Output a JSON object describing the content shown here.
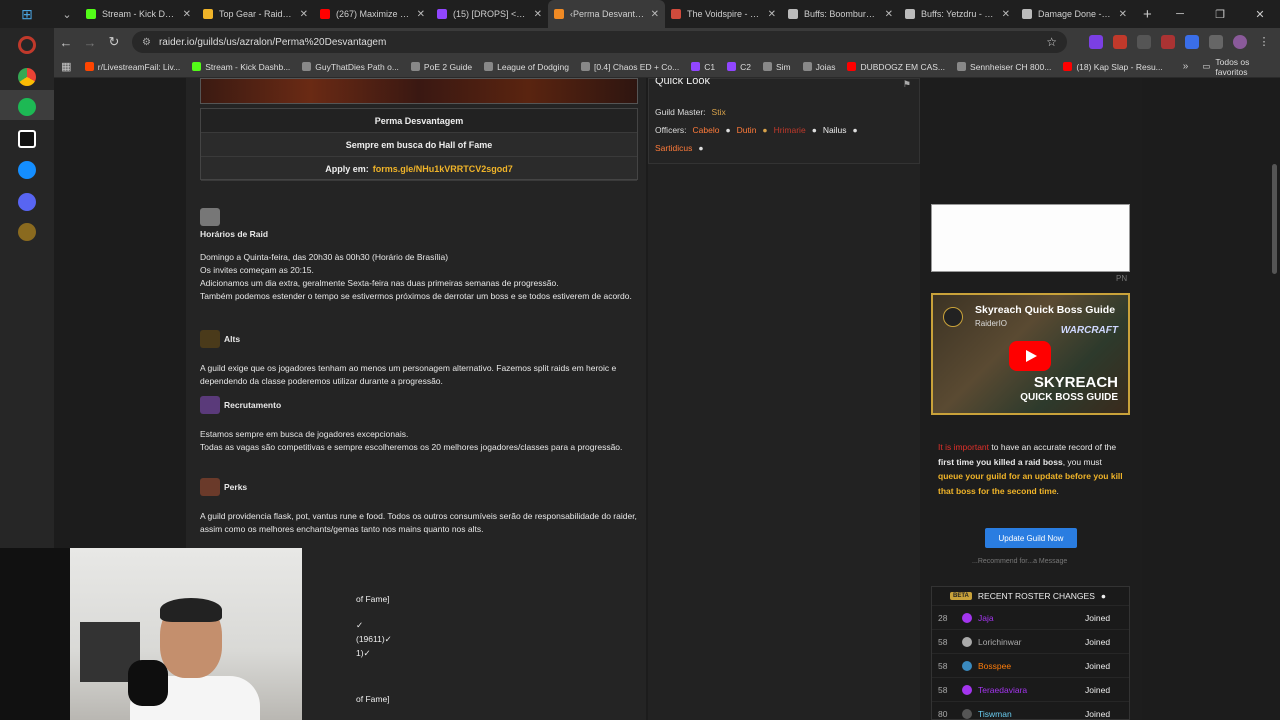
{
  "tabs": [
    {
      "title": "Stream - Kick Dashb",
      "color": "#53fc18",
      "active": false
    },
    {
      "title": "Top Gear - Raidbots",
      "color": "#f0b429",
      "active": false
    },
    {
      "title": "(267) Maximize you",
      "color": "#ff0000",
      "active": false
    },
    {
      "title": "(15) [DROPS] <Echo",
      "color": "#9146ff",
      "active": false
    },
    {
      "title": "‹Perma Desvantage",
      "color": "#f08a24",
      "active": true
    },
    {
      "title": "The Voidspire - Qu",
      "color": "#d14b3c",
      "active": false
    },
    {
      "title": "Buffs: Boomburger",
      "color": "#bbbbbb",
      "active": false
    },
    {
      "title": "Buffs: Yetzdru - Cro",
      "color": "#bbbbbb",
      "active": false
    },
    {
      "title": "Damage Done - Cr",
      "color": "#bbbbbb",
      "active": false
    }
  ],
  "address": {
    "url": "raider.io/guilds/us/azralon/Perma%20Desvantagem"
  },
  "bookmarks": [
    {
      "label": "r/LivestreamFail: Liv...",
      "color": "#ff4500"
    },
    {
      "label": "Stream - Kick Dashb...",
      "color": "#53fc18"
    },
    {
      "label": "GuyThatDies Path o...",
      "color": "#888888"
    },
    {
      "label": "PoE 2 Guide",
      "color": "#888888"
    },
    {
      "label": "League of Dodging",
      "color": "#888888"
    },
    {
      "label": "[0.4] Chaos ED + Co...",
      "color": "#888888"
    },
    {
      "label": "C1",
      "color": "#9146ff"
    },
    {
      "label": "C2",
      "color": "#9146ff"
    },
    {
      "label": "Sim",
      "color": "#888888"
    },
    {
      "label": "Joias",
      "color": "#888888"
    },
    {
      "label": "DUBDOGZ EM CAS...",
      "color": "#ff0000"
    },
    {
      "label": "Sennheiser CH 800...",
      "color": "#888888"
    },
    {
      "label": "(18) Kap Slap - Resu...",
      "color": "#ff0000"
    }
  ],
  "bookmarks_all": "Todos os favoritos",
  "guild_info": {
    "name": "Perma Desvantagem",
    "tagline": "Sempre em busca do Hall of Fame",
    "apply_label": "Apply em:",
    "apply_link": "forms.gle/NHu1kVRRTCV2sgod7"
  },
  "raid_section": {
    "title": "Horários de Raid",
    "lines": [
      "Domingo a Quinta-feira, das 20h30 às 00h30 (Horário de Brasília)",
      "Os invites começam as 20:15.",
      "Adicionamos um dia extra, geralmente Sexta-feira nas duas primeiras semanas de progressão.",
      "Também podemos estender o tempo se estivermos próximos de derrotar um boss e se todos estiverem de acordo."
    ]
  },
  "alts_section": {
    "title": "Alts",
    "text": "A guild exige que os jogadores tenham ao menos um personagem alternativo. Fazemos split raids em heroic e dependendo da classe poderemos utilizar durante a progressão."
  },
  "recruit_section": {
    "title": "Recrutamento",
    "lines": [
      "Estamos sempre em busca de jogadores excepcionais.",
      "Todas as vagas são competitivas e sempre escolheremos os 20 melhores jogadores/classes para a progressão."
    ]
  },
  "perks_section": {
    "title": "Perks",
    "text": "A guild providencia flask, pot, vantus rune e food. Todos os outros consumíveis serão de responsabilidade do raider, assim como os melhores enchants/gemas tanto nos mains quanto nos alts."
  },
  "behind_cam": {
    "line1": "of Fame]",
    "line2": "✓",
    "line3": "(19611)✓",
    "line4": "1)✓",
    "line5": "of Fame]"
  },
  "quick_look": {
    "title": "Quick Look",
    "gm_label": "Guild Master:",
    "gm_name": "Stix",
    "officers_label": "Officers:",
    "officers": [
      "Cabelo",
      "Dutin",
      "Hrimarie",
      "Nailus",
      "Sartidicus"
    ]
  },
  "ad_label": "PN",
  "video": {
    "title": "Skyreach Quick Boss Guide",
    "channel": "RaiderIO",
    "brand": "WARCRAFT",
    "big1": "SKYREACH",
    "big2": "QUICK BOSS GUIDE"
  },
  "note": {
    "p1_red": "It is important",
    "p1a": " to have an accurate record of the ",
    "p1b": "first time you killed a raid boss",
    "p1c": ", you must ",
    "p1d": "queue your guild for an update before you kill that boss for the second time",
    "p1e": "."
  },
  "update_button": "Update Guild Now",
  "small_link": "...Recommend for...a Message",
  "roster": {
    "title": "RECENT ROSTER CHANGES",
    "beta": "BETA",
    "rows": [
      {
        "lvl": "28",
        "name": "Jaja",
        "status": "Joined",
        "color": "#a335ee"
      },
      {
        "lvl": "58",
        "name": "Lorichinwar",
        "status": "Joined",
        "color": "#aaaaaa"
      },
      {
        "lvl": "58",
        "name": "Bosspee",
        "status": "Joined",
        "color": "#ff7d0a"
      },
      {
        "lvl": "58",
        "name": "Teraedaviara",
        "status": "Joined",
        "color": "#a335ee"
      },
      {
        "lvl": "80",
        "name": "Tiswman",
        "status": "Joined",
        "color": "#69ccf0"
      }
    ]
  }
}
